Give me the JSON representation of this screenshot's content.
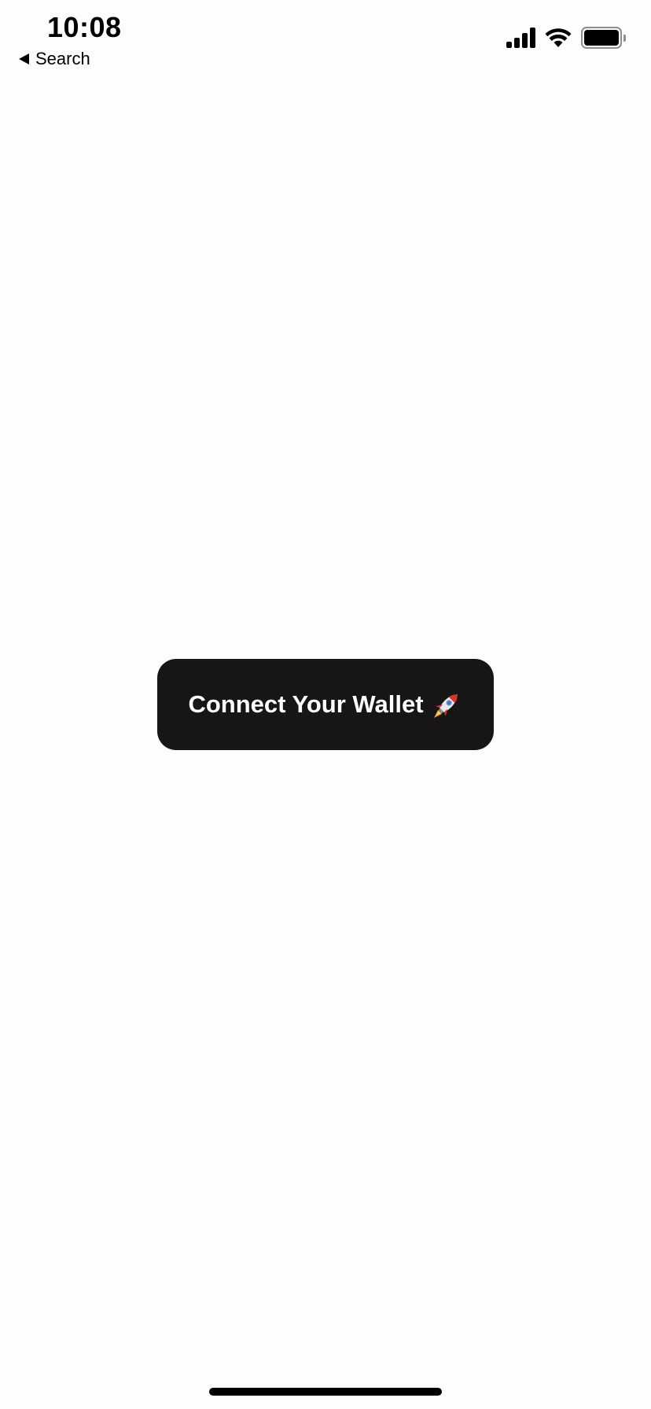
{
  "status_bar": {
    "time": "10:08",
    "back_label": "Search",
    "icons": [
      "cellular-signal-icon",
      "wifi-icon",
      "battery-icon"
    ]
  },
  "main": {
    "connect_button": {
      "label": "Connect Your Wallet",
      "emoji": "rocket-icon",
      "background": "#161616",
      "text_color": "#ffffff"
    }
  },
  "colors": {
    "background": "#fdfdfd",
    "button": "#161616"
  }
}
